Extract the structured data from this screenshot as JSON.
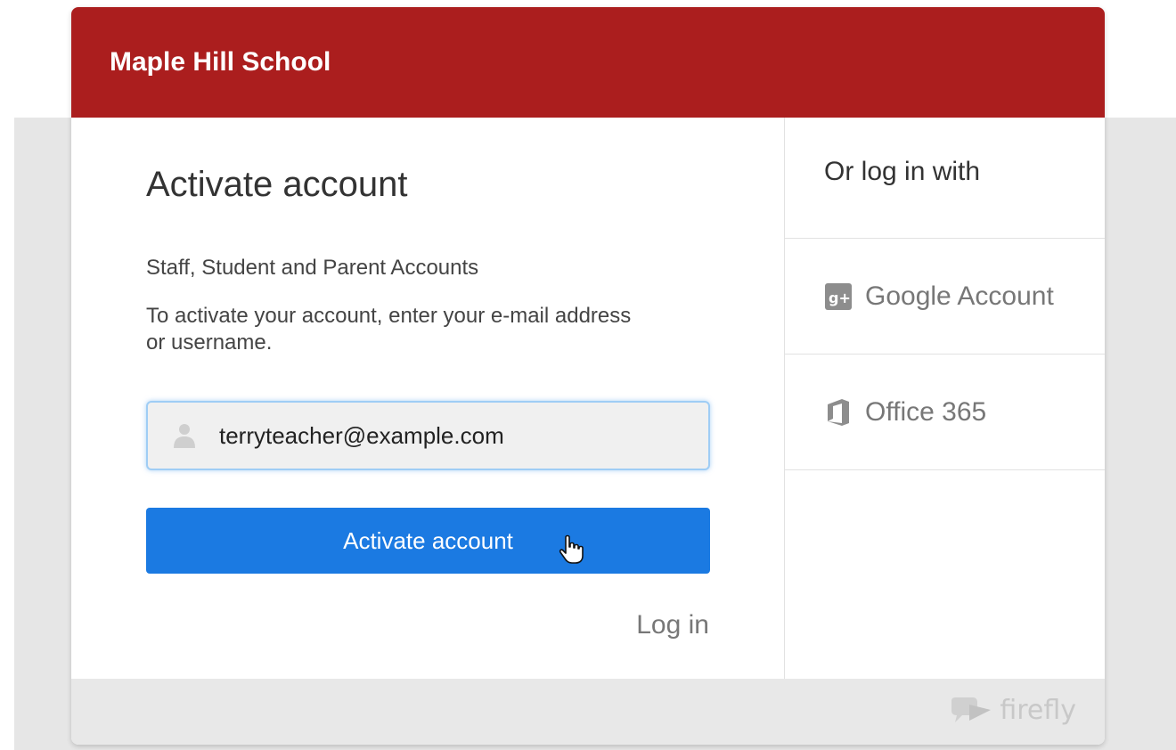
{
  "header": {
    "school_name": "Maple Hill School",
    "color": "#ab1e1e"
  },
  "main": {
    "title": "Activate account",
    "section_label": "Staff, Student and Parent Accounts",
    "instructions": "To activate your account, enter your e-mail address or username.",
    "email_input": {
      "value": "terryteacher@example.com",
      "icon": "user-icon"
    },
    "activate_button": {
      "label": "Activate account",
      "color": "#1b7ae2"
    },
    "login_link": "Log in"
  },
  "sidebar": {
    "heading": "Or log in with",
    "providers": [
      {
        "label": "Google Account",
        "icon": "google-plus-icon"
      },
      {
        "label": "Office 365",
        "icon": "office-icon"
      }
    ]
  },
  "footer": {
    "brand": "firefly",
    "brand_icon": "firefly-logo-icon"
  }
}
